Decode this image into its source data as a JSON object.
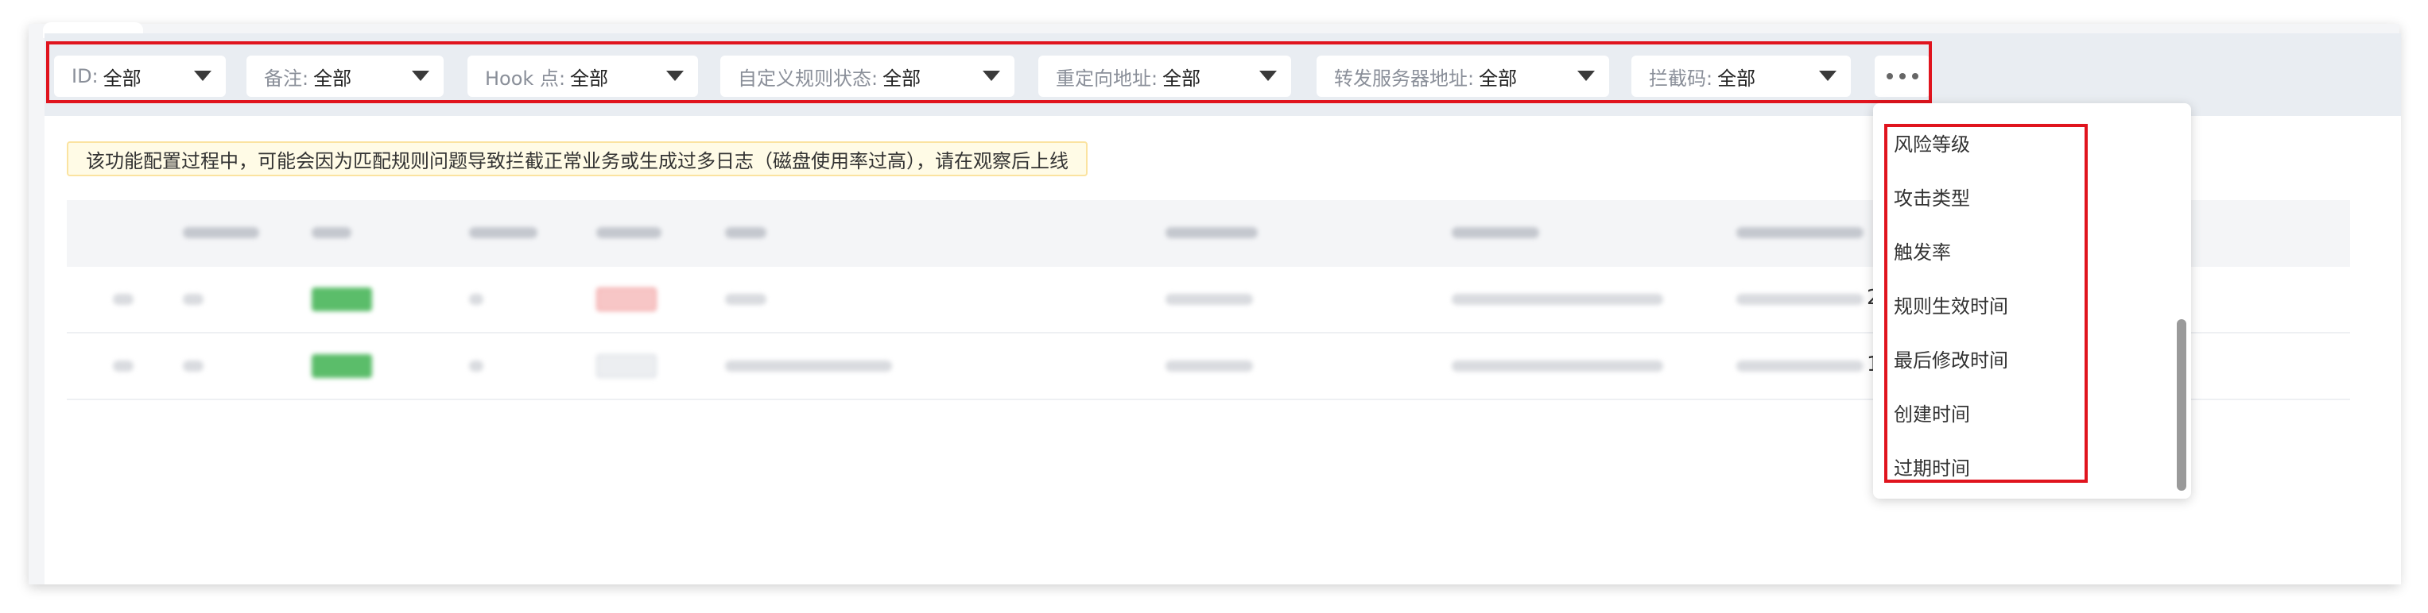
{
  "filters": [
    {
      "label": "ID:",
      "value": "全部"
    },
    {
      "label": "备注:",
      "value": "全部"
    },
    {
      "label": "Hook 点:",
      "value": "全部"
    },
    {
      "label": "自定义规则状态:",
      "value": "全部"
    },
    {
      "label": "重定向地址:",
      "value": "全部"
    },
    {
      "label": "转发服务器地址:",
      "value": "全部"
    },
    {
      "label": "拦截码:",
      "value": "全部"
    }
  ],
  "more_icon": "ellipsis-icon",
  "warning": "该功能配置过程中，可能会因为匹配规则问题导致拦截正常业务或生成过多日志（磁盘使用率过高），请在观察后上线",
  "table": {
    "rows_partial_visible_text": [
      "2",
      "1"
    ]
  },
  "dropdown": {
    "items": [
      "风险等级",
      "攻击类型",
      "触发率",
      "规则生效时间",
      "最后修改时间",
      "创建时间",
      "过期时间"
    ]
  },
  "colors": {
    "highlight": "#e0141e",
    "enabled_tag": "#5bbd6a",
    "warning_bg": "#fffbe6"
  }
}
